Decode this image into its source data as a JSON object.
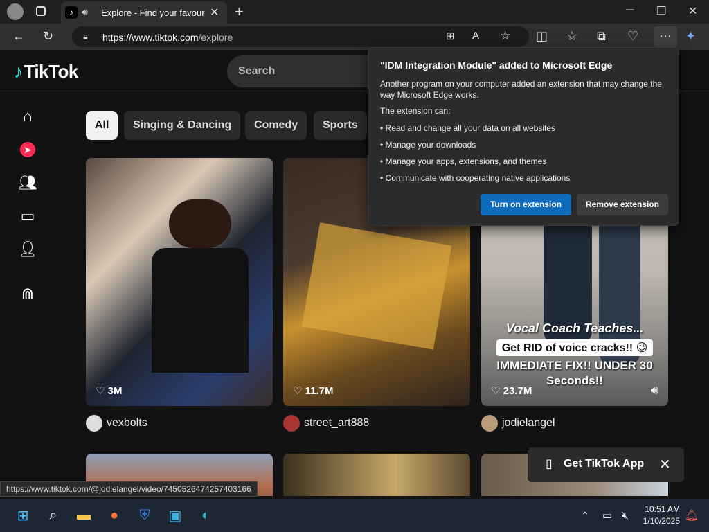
{
  "browser": {
    "tab_title": "Explore - Find your favourite",
    "url_host": "https://www.tiktok.com",
    "url_path": "/explore",
    "status_url": "https://www.tiktok.com/@jodielangel/video/7450526474257403166"
  },
  "site": {
    "logo": "TikTok",
    "search_placeholder": "Search",
    "categories": [
      "All",
      "Singing & Dancing",
      "Comedy",
      "Sports"
    ],
    "videos": [
      {
        "likes": "3M",
        "author": "vexbolts"
      },
      {
        "likes": "11.7M",
        "author": "street_art888"
      },
      {
        "likes": "23.7M",
        "author": "jodielangel",
        "caption1": "Vocal Coach Teaches...",
        "caption2": "Get RID of voice cracks!! 😉",
        "caption3": "IMMEDIATE FIX!! UNDER 30",
        "caption4": "Seconds!!"
      }
    ],
    "get_app": "Get TikTok App"
  },
  "popup": {
    "title": "\"IDM Integration Module\" added to Microsoft Edge",
    "description": "Another program on your computer added an extension that may change the way Microsoft Edge works.",
    "can_label": "The extension can:",
    "bullets": [
      "• Read and change all your data on all websites",
      "• Manage your downloads",
      "• Manage your apps, extensions, and themes",
      "• Communicate with cooperating native applications"
    ],
    "turn_on": "Turn on extension",
    "remove": "Remove extension"
  },
  "taskbar": {
    "time": "10:51 AM",
    "date": "1/10/2025"
  },
  "colors": {
    "accent_blue": "#0f6cbd",
    "tiktok_red": "#fe2c55",
    "tiktok_cyan": "#25f4ee"
  }
}
